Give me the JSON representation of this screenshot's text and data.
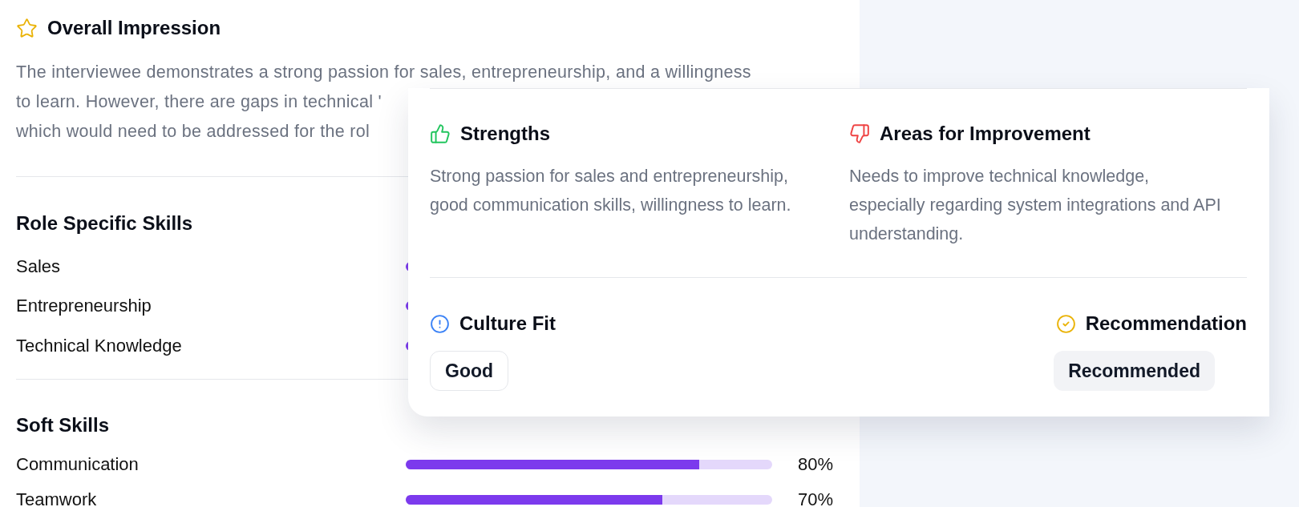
{
  "overall": {
    "title": "Overall Impression",
    "lines": [
      "The interviewee demonstrates a strong passion for sales, entrepreneurship, and a willingness",
      "to learn. However, there are gaps in technical '",
      "which would need to be addressed for the rol"
    ]
  },
  "skill_groups": [
    {
      "title": "Role Specific Skills",
      "skills": [
        {
          "name": "Sales"
        },
        {
          "name": "Entrepreneurship"
        },
        {
          "name": "Technical Knowledge"
        }
      ]
    },
    {
      "title": "Soft Skills",
      "skills": [
        {
          "name": "Communication",
          "level": 0.8,
          "percent": "80%"
        },
        {
          "name": "Teamwork",
          "level": 0.7,
          "percent": "70%"
        }
      ]
    }
  ],
  "popover": {
    "columns": [
      {
        "kind": "strengths",
        "title": "Strengths",
        "text": "Strong passion for sales and entrepreneurship, good communication skills, willingness to learn."
      },
      {
        "kind": "improvement",
        "title": "Areas for Improvement",
        "text": "Needs to improve technical knowledge, especially regarding system integrations and API understanding."
      }
    ],
    "culture_fit": {
      "title": "Culture Fit",
      "value": "Good"
    },
    "recommendation": {
      "title": "Recommendation",
      "value": "Recommended"
    }
  }
}
